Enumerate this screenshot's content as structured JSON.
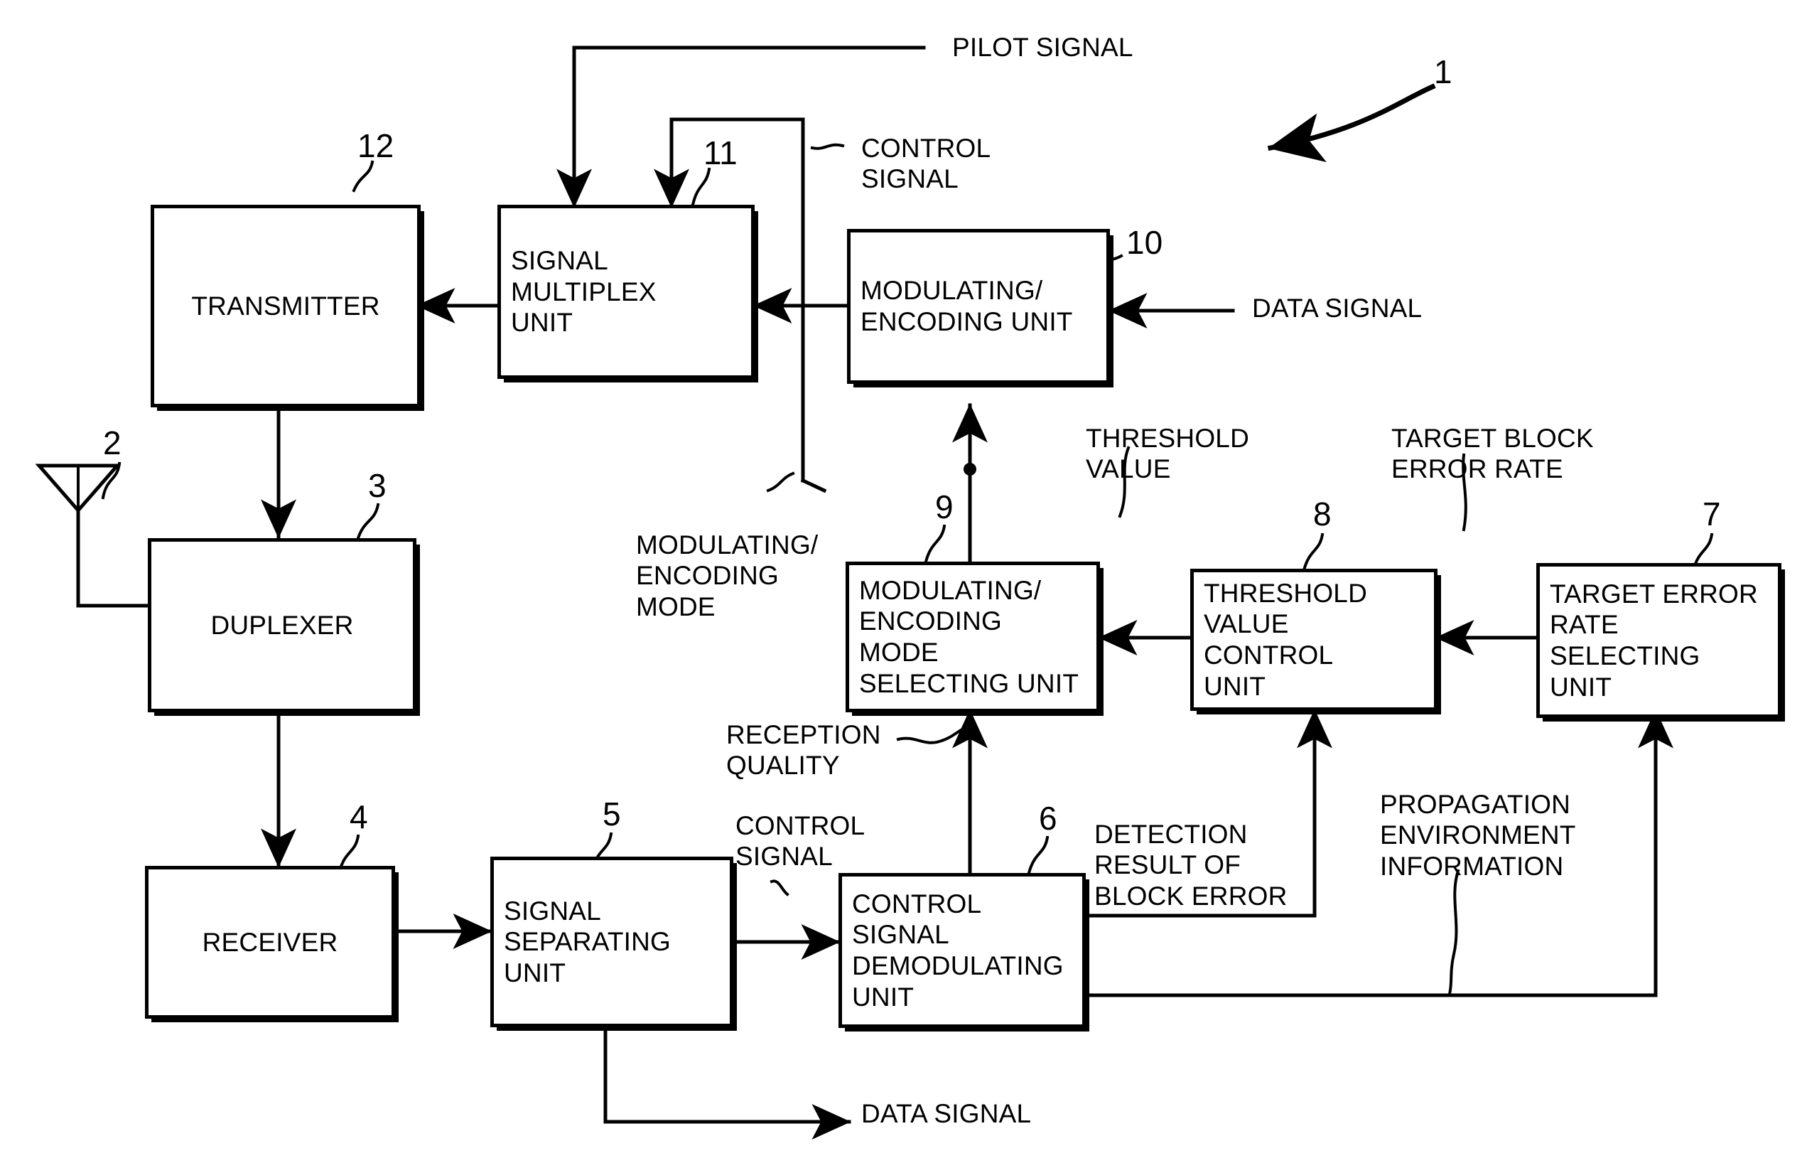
{
  "figure": {
    "reference_label": "1"
  },
  "blocks": [
    {
      "id": "transmitter",
      "ref": "12",
      "label": "TRANSMITTER",
      "align": "center"
    },
    {
      "id": "signal_multiplex",
      "ref": "11",
      "label": "SIGNAL\nMULTIPLEX\nUNIT",
      "align": "left"
    },
    {
      "id": "mod_enc_unit",
      "ref": "10",
      "label": "MODULATING/\nENCODING UNIT",
      "align": "left"
    },
    {
      "id": "duplexer",
      "ref": "3",
      "label": "DUPLEXER",
      "align": "center"
    },
    {
      "id": "receiver",
      "ref": "4",
      "label": "RECEIVER",
      "align": "center"
    },
    {
      "id": "signal_separating",
      "ref": "5",
      "label": "SIGNAL\nSEPARATING\nUNIT",
      "align": "left"
    },
    {
      "id": "ctrl_sig_demod",
      "ref": "6",
      "label": "CONTROL\nSIGNAL\nDEMODULATING\nUNIT",
      "align": "left"
    },
    {
      "id": "mode_selecting",
      "ref": "9",
      "label": "MODULATING/\nENCODING MODE\nSELECTING UNIT",
      "align": "left"
    },
    {
      "id": "threshold_ctrl",
      "ref": "8",
      "label": "THRESHOLD\nVALUE CONTROL\nUNIT",
      "align": "left"
    },
    {
      "id": "target_err_rate",
      "ref": "7",
      "label": "TARGET ERROR\nRATE SELECTING\nUNIT",
      "align": "left"
    }
  ],
  "labels": {
    "pilot_signal": "PILOT SIGNAL",
    "control_signal_top": "CONTROL\nSIGNAL",
    "data_signal_in": "DATA SIGNAL",
    "mod_enc_mode": "MODULATING/\nENCODING\nMODE",
    "threshold_value": "THRESHOLD\nVALUE",
    "target_block_error_rate": "TARGET BLOCK\nERROR RATE",
    "reception_quality": "RECEPTION\nQUALITY",
    "control_signal_mid": "CONTROL\nSIGNAL",
    "detection_result": "DETECTION\nRESULT OF\nBLOCK ERROR",
    "propagation_env": "PROPAGATION\nENVIRONMENT\nINFORMATION",
    "data_signal_out": "DATA SIGNAL"
  },
  "antenna": {
    "ref": "2",
    "name": "antenna-symbol"
  },
  "colors": {
    "ink": "#000000",
    "paper": "#ffffff"
  }
}
